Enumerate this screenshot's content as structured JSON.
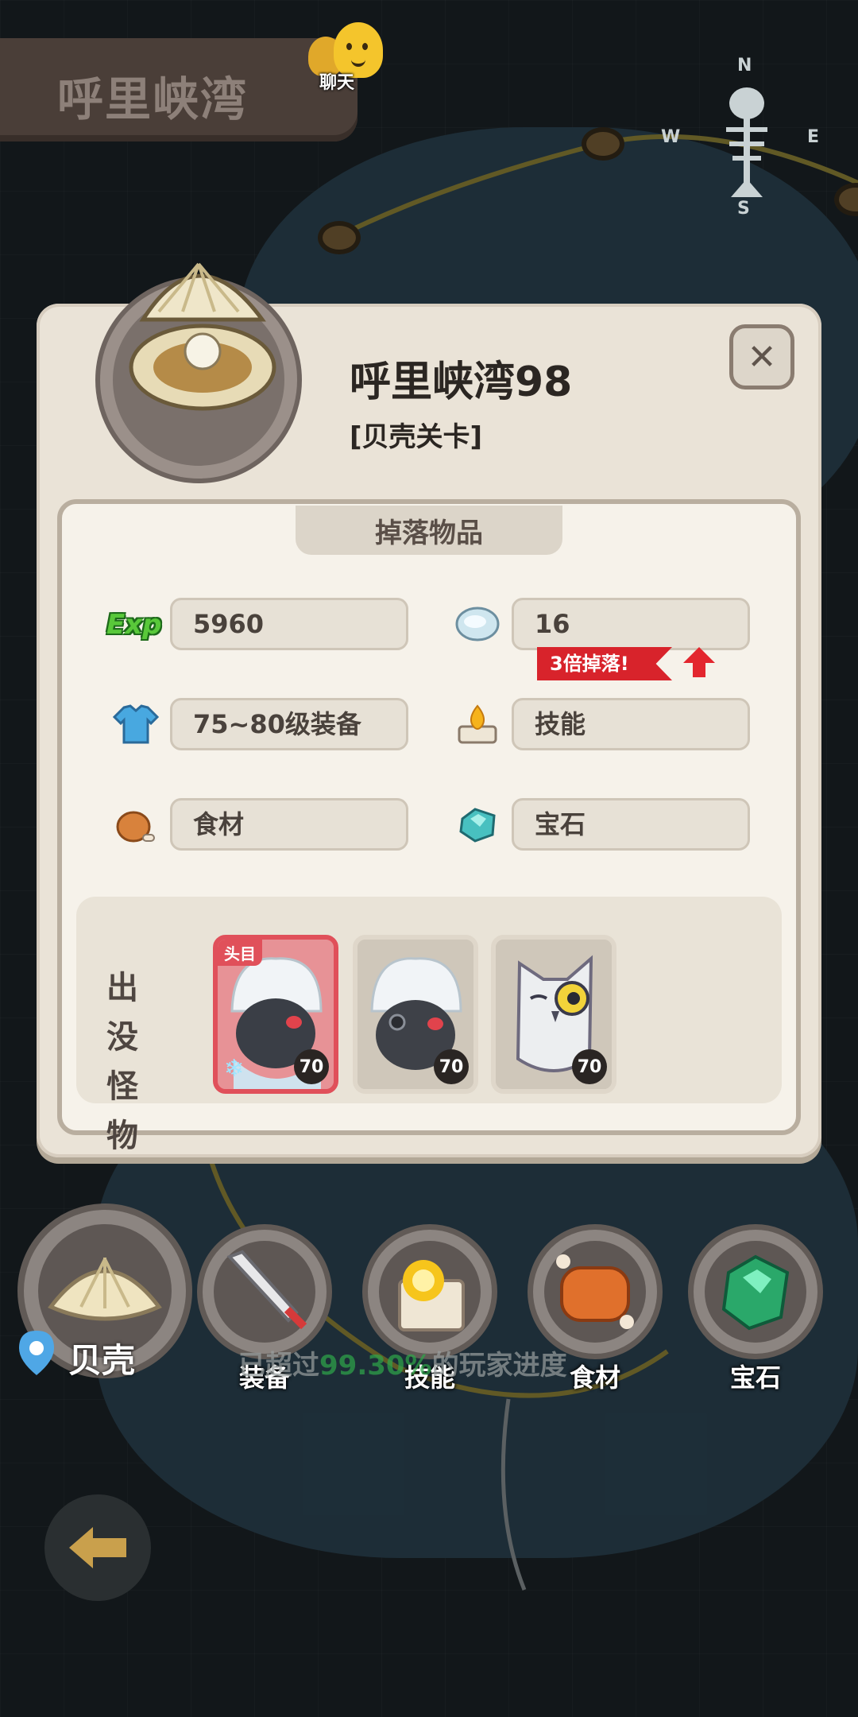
{
  "header": {
    "title": "呼里峡湾"
  },
  "chat": {
    "label": "聊天",
    "icon": "chat-bubble-icon"
  },
  "compass": {
    "n": "N",
    "s": "S",
    "e": "E",
    "w": "W"
  },
  "panel": {
    "stage_title": "呼里峡湾98",
    "stage_type": "[贝壳关卡]",
    "close_icon": "close-icon",
    "drops_heading": "掉落物品",
    "drops": [
      {
        "icon": "exp-icon",
        "icon_text": "Exp",
        "value": "5960"
      },
      {
        "icon": "shell-currency-icon",
        "value": "16"
      },
      {
        "icon": "equipment-shirt-icon",
        "value": "75~80级装备"
      },
      {
        "icon": "skill-flame-icon",
        "value": "技能"
      },
      {
        "icon": "food-meat-icon",
        "value": "食材"
      },
      {
        "icon": "gem-icon",
        "value": "宝石"
      }
    ],
    "bonus_tag": "3倍掉落!",
    "monsters_label": "出没怪物",
    "monsters": [
      {
        "name": "yeti-boss",
        "boss_tag": "头目",
        "level": "70"
      },
      {
        "name": "yeti",
        "level": "70"
      },
      {
        "name": "owl",
        "level": "70"
      }
    ]
  },
  "bottom": {
    "current_location": "贝壳",
    "categories": [
      {
        "label": "装备",
        "icon": "sword-icon"
      },
      {
        "label": "技能",
        "icon": "skill-scroll-icon"
      },
      {
        "label": "食材",
        "icon": "meat-icon"
      },
      {
        "label": "宝石",
        "icon": "gem-icon"
      }
    ],
    "progress_prefix": "已超过",
    "progress_pct": "99.30%",
    "progress_suffix": "的玩家进度"
  },
  "colors": {
    "boss_red": "#e0505a",
    "bonus_red": "#d8232b",
    "exp_green": "#59c83a"
  }
}
